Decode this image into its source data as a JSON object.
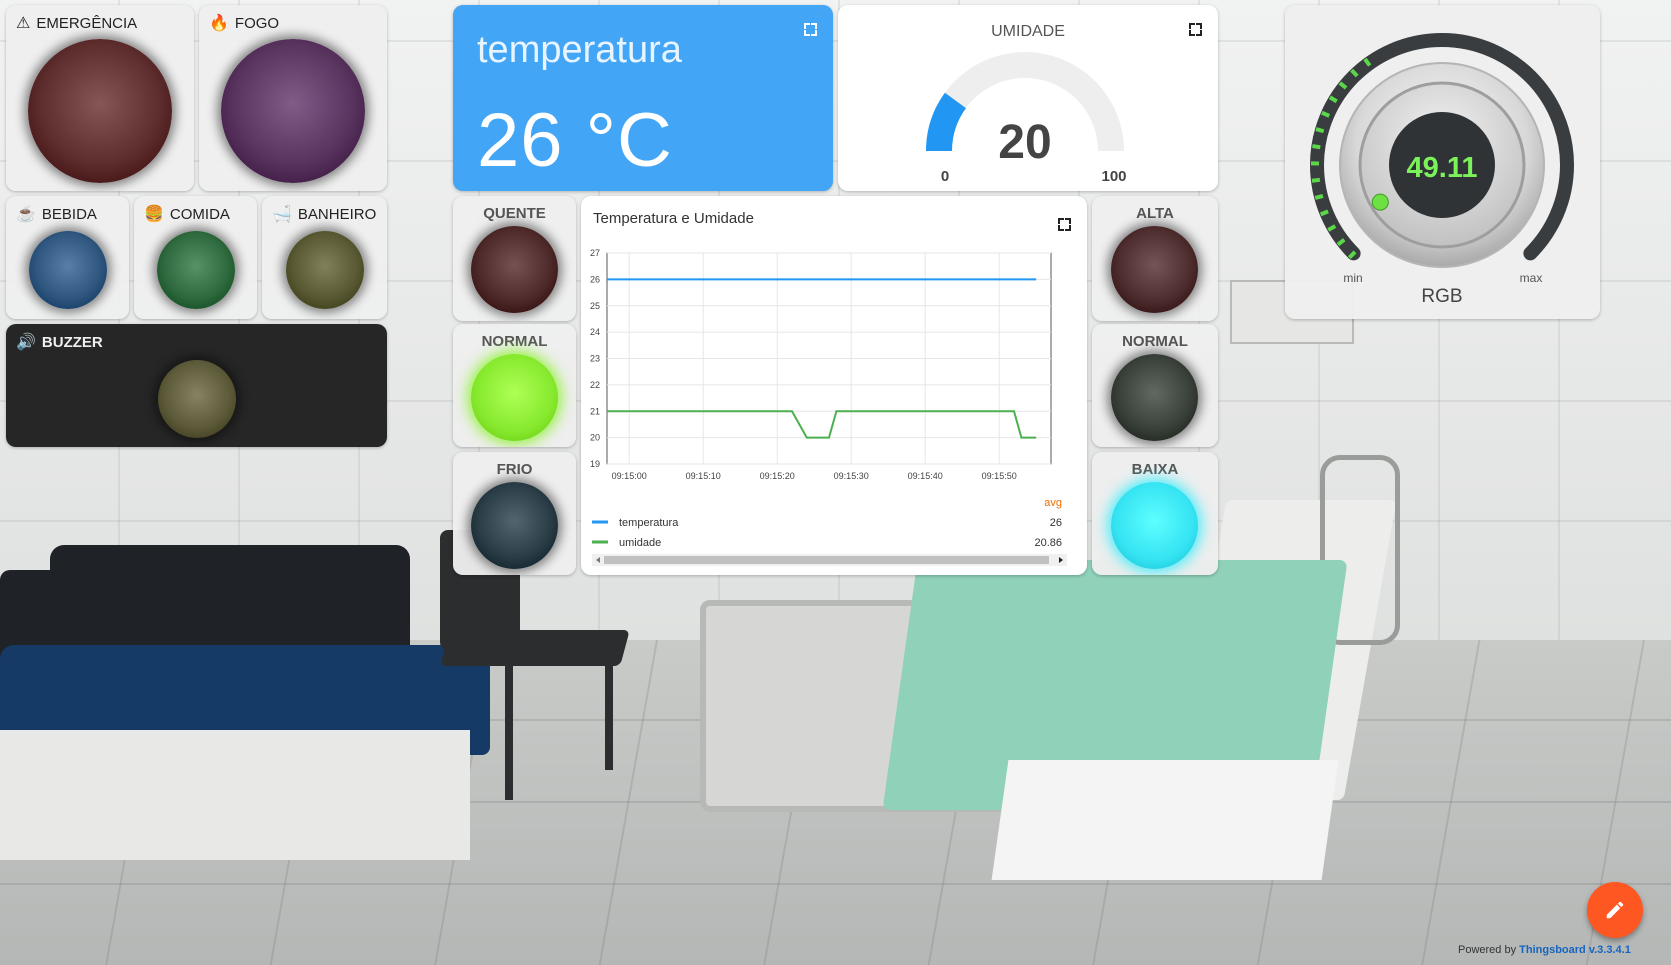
{
  "leds_top": [
    {
      "id": "emergencia",
      "label": "EMERGÊNCIA",
      "icon": "warning-icon",
      "color": "#5e2e2e"
    },
    {
      "id": "fogo",
      "label": "FOGO",
      "icon": "fire-icon",
      "color": "#58345f"
    }
  ],
  "leds_mid": [
    {
      "id": "bebida",
      "label": "BEBIDA",
      "icon": "cup-icon",
      "color": "#2f577f"
    },
    {
      "id": "comida",
      "label": "COMIDA",
      "icon": "burger-icon",
      "color": "#2f6a3f"
    },
    {
      "id": "banheiro",
      "label": "BANHEIRO",
      "icon": "bath-icon",
      "color": "#595934"
    }
  ],
  "buzzer": {
    "label": "BUZZER",
    "icon": "speaker-icon",
    "color": "#5d5b3a"
  },
  "temperature": {
    "title": "temperatura",
    "value": "26 °C"
  },
  "humidity": {
    "title": "UMIDADE",
    "value": "20",
    "min": "0",
    "max": "100",
    "level": 20
  },
  "temp_leds": [
    {
      "id": "quente",
      "label": "QUENTE",
      "color": "#4e2a2a"
    },
    {
      "id": "normal",
      "label": "NORMAL",
      "color": "#86e92d",
      "on": true
    },
    {
      "id": "frio",
      "label": "FRIO",
      "color": "#2b3e47"
    }
  ],
  "hum_leds": [
    {
      "id": "alta",
      "label": "ALTA",
      "color": "#4e2d2f"
    },
    {
      "id": "normal",
      "label": "NORMAL",
      "color": "#39413a"
    },
    {
      "id": "baixa",
      "label": "BAIXA",
      "color": "#35e3f2",
      "on": true
    }
  ],
  "chart": {
    "title": "Temperatura e Umidade",
    "avg_label": "avg",
    "legend": [
      {
        "name": "temperatura",
        "color": "#2196f3",
        "avg": "26"
      },
      {
        "name": "umidade",
        "color": "#4caf50",
        "avg": "20.86"
      }
    ]
  },
  "chart_data": {
    "type": "line",
    "x": [
      "09:15:00",
      "09:15:10",
      "09:15:20",
      "09:15:30",
      "09:15:40",
      "09:15:50"
    ],
    "ylim": [
      19,
      27
    ],
    "yticks": [
      19,
      20,
      21,
      22,
      23,
      24,
      25,
      26,
      27
    ],
    "xrange": [
      0,
      60
    ],
    "series": [
      {
        "name": "temperatura",
        "color": "#2196f3",
        "points": [
          [
            0,
            26
          ],
          [
            58,
            26
          ]
        ]
      },
      {
        "name": "umidade",
        "color": "#4caf50",
        "points": [
          [
            0,
            21
          ],
          [
            25,
            21
          ],
          [
            27,
            20
          ],
          [
            30,
            20
          ],
          [
            31,
            21
          ],
          [
            55,
            21
          ],
          [
            56,
            20
          ],
          [
            58,
            20
          ]
        ]
      }
    ]
  },
  "knob": {
    "value": "49.11",
    "min_label": "min",
    "max_label": "max",
    "title": "RGB",
    "level": 0.4911
  },
  "footer": {
    "powered_by": "Powered by",
    "brand": "Thingsboard v.3.3.4.1"
  },
  "fab": {
    "icon": "edit-icon"
  }
}
